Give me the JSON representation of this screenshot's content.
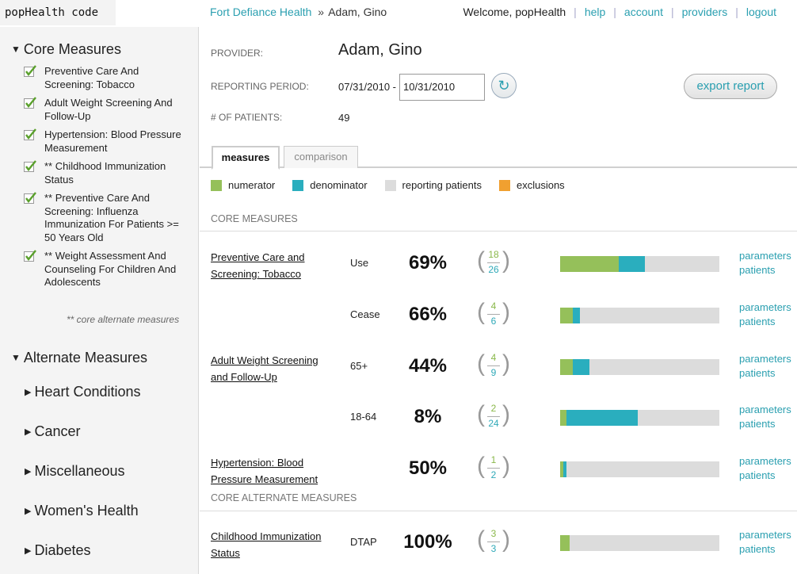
{
  "app": {
    "logo": "popHealth code"
  },
  "breadcrumb": {
    "organization": "Fort Defiance Health",
    "separator": "»",
    "current": "Adam, Gino"
  },
  "topnav": {
    "welcome": "Welcome, popHealth",
    "links": [
      "help",
      "account",
      "providers",
      "logout"
    ]
  },
  "sidebar": {
    "core_title": "Core Measures",
    "core_items": [
      "Preventive Care And Screening: Tobacco",
      "Adult Weight Screening And Follow-Up",
      "Hypertension: Blood Pressure Measurement",
      "** Childhood Immunization Status",
      "** Preventive Care And Screening: Influenza Immunization For Patients >= 50 Years Old",
      "** Weight Assessment And Counseling For Children And Adolescents"
    ],
    "core_note": "** core alternate measures",
    "alt_title": "Alternate Measures",
    "alt_items": [
      "Heart Conditions",
      "Cancer",
      "Miscellaneous",
      "Women's Health",
      "Diabetes"
    ]
  },
  "header": {
    "provider_label": "PROVIDER:",
    "provider_name": "Adam, Gino",
    "period_label": "REPORTING PERIOD:",
    "period_start": "07/31/2010 -",
    "period_end": "10/31/2010",
    "patients_label": "# OF PATIENTS:",
    "patients_count": "49",
    "export_label": "export report"
  },
  "tabs": [
    "measures",
    "comparison"
  ],
  "legend": [
    {
      "label": "numerator",
      "color": "#95c05a"
    },
    {
      "label": "denominator",
      "color": "#2aaebe"
    },
    {
      "label": "reporting patients",
      "color": "#dcdcdc"
    },
    {
      "label": "exclusions",
      "color": "#f0a030"
    }
  ],
  "groups": {
    "core": "CORE MEASURES",
    "core_alternate": "CORE ALTERNATE MEASURES"
  },
  "link_labels": {
    "parameters": "parameters",
    "patients": "patients"
  },
  "measures": [
    {
      "name": "Preventive Care and Screening: Tobacco",
      "sub": "Use",
      "pct": "69%",
      "num": "18",
      "den": "26",
      "num_frac": 0.367,
      "den_frac": 0.531
    },
    {
      "name": "",
      "sub": "Cease",
      "pct": "66%",
      "num": "4",
      "den": "6",
      "num_frac": 0.082,
      "den_frac": 0.122
    },
    {
      "name": "Adult Weight Screening and Follow-Up",
      "sub": "65+",
      "pct": "44%",
      "num": "4",
      "den": "9",
      "num_frac": 0.082,
      "den_frac": 0.184
    },
    {
      "name": "",
      "sub": "18-64",
      "pct": "8%",
      "num": "2",
      "den": "24",
      "num_frac": 0.041,
      "den_frac": 0.49
    },
    {
      "name": "Hypertension: Blood Pressure Measurement",
      "sub": "",
      "pct": "50%",
      "num": "1",
      "den": "2",
      "num_frac": 0.02,
      "den_frac": 0.041
    },
    {
      "name": "Childhood Immunization Status",
      "sub": "DTAP",
      "pct": "100%",
      "num": "3",
      "den": "3",
      "num_frac": 0.061,
      "den_frac": 0.061
    }
  ]
}
